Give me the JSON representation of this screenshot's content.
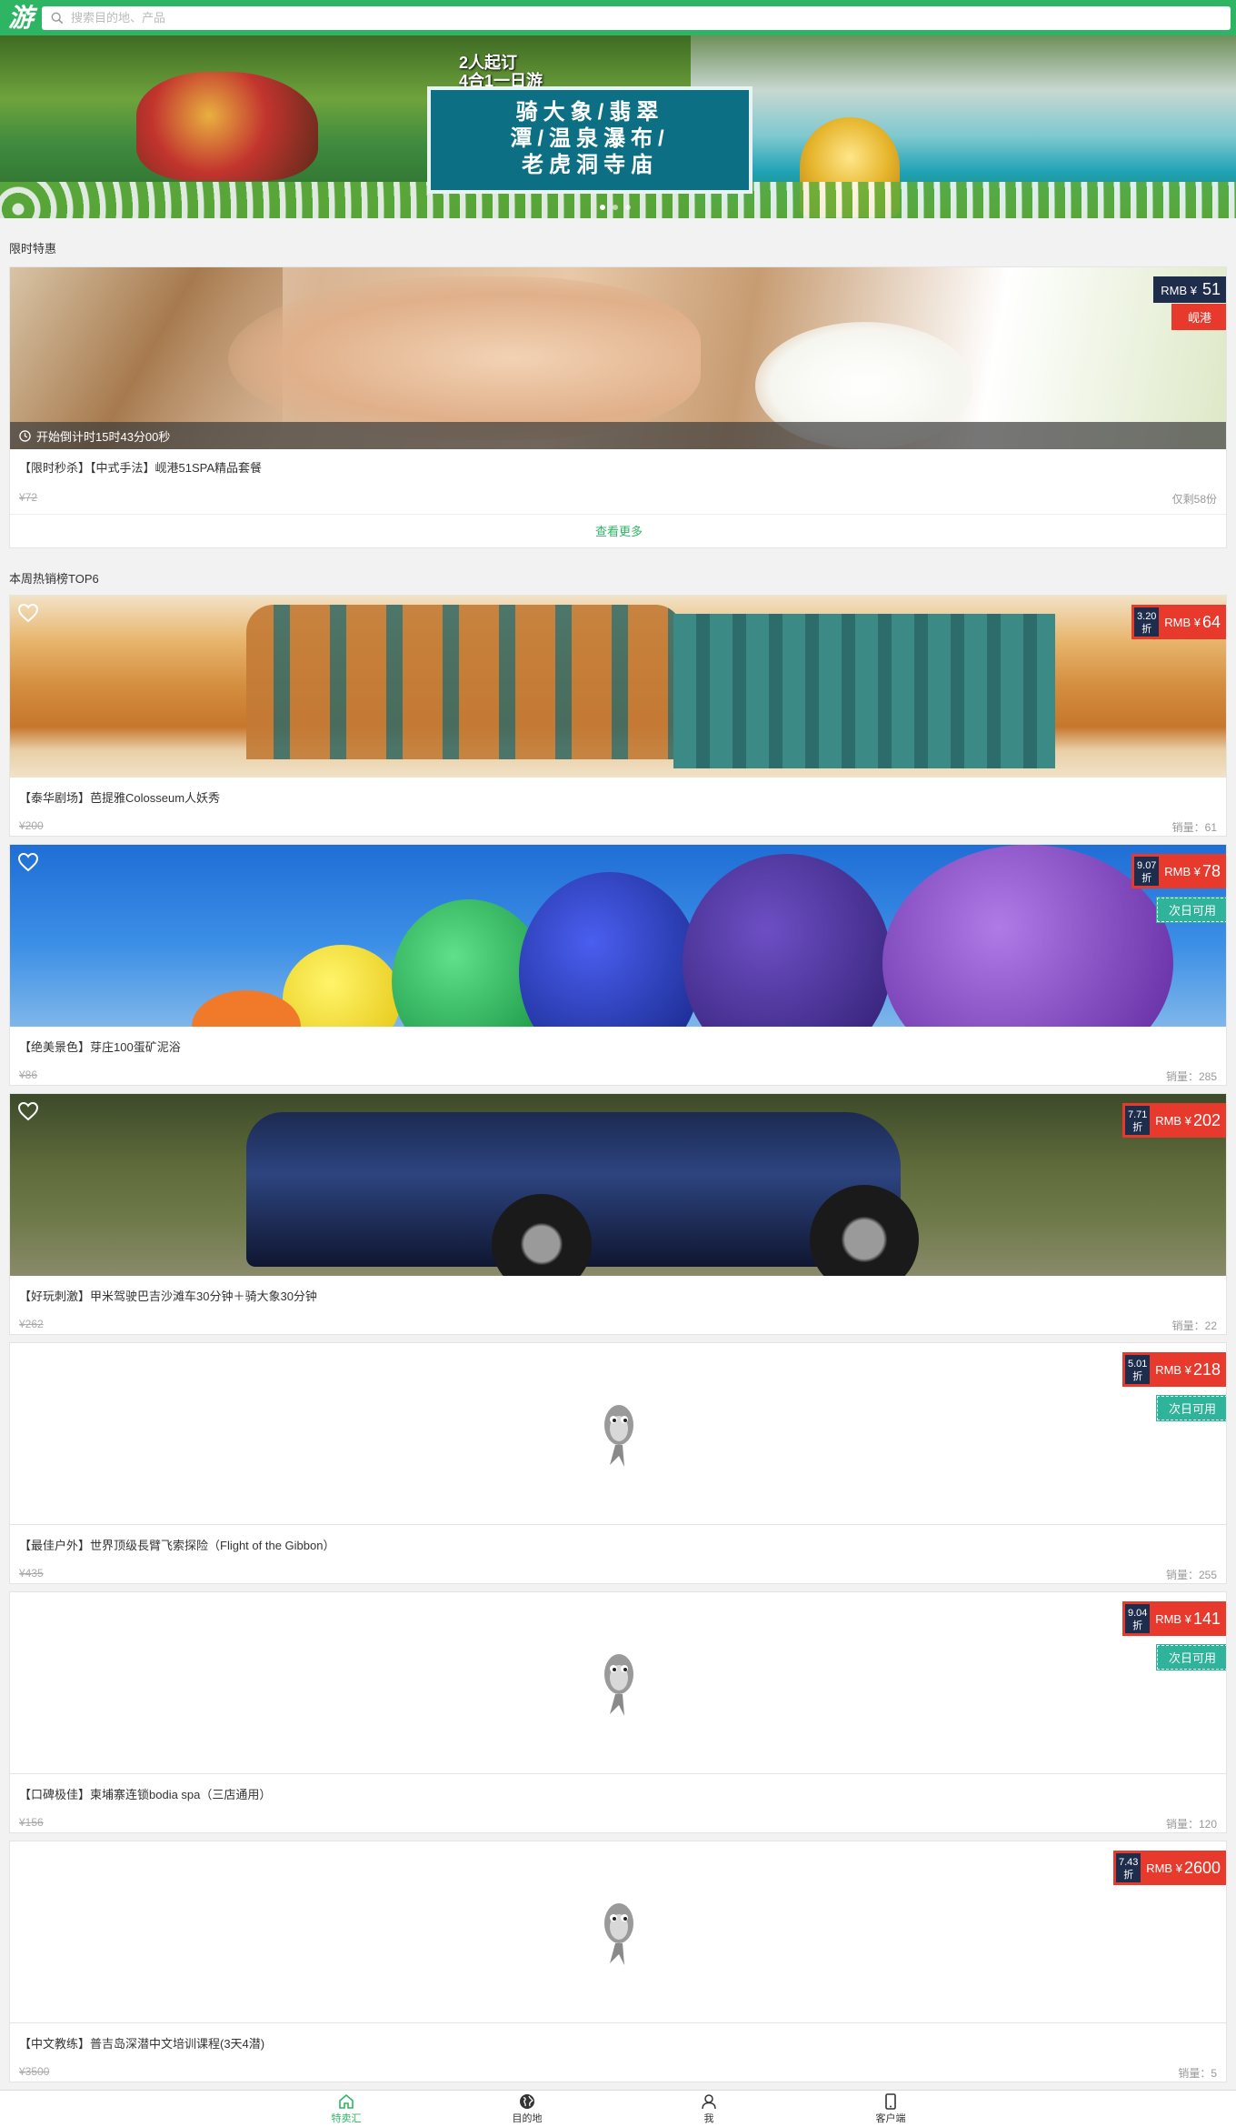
{
  "header": {
    "logo_text": "游",
    "search_placeholder": "搜索目的地、产品"
  },
  "banner": {
    "top_text_line1": "2人起订",
    "top_text_line2": "4合1一日游",
    "sign_line1": "骑大象/翡翠",
    "sign_line2": "潭/温泉瀑布/",
    "sign_line3": "老虎洞寺庙"
  },
  "flash_sale": {
    "section_title": "限时特惠",
    "price_currency": "RMB ¥",
    "price": "51",
    "city": "岘港",
    "countdown": "开始倒计时15时43分00秒",
    "title": "【限时秒杀】【中式手法】岘港51SPA精品套餐",
    "original_price": "¥72",
    "remaining": "仅剩58份",
    "more_label": "查看更多"
  },
  "top_list": {
    "section_title": "本周热销榜TOP6",
    "items": [
      {
        "discount": "3.20",
        "discount_unit": "折",
        "currency": "RMB ¥",
        "price": "64",
        "title": "【泰华剧场】芭提雅Colosseum人妖秀",
        "original_price": "¥200",
        "sales": "销量：61"
      },
      {
        "discount": "9.07",
        "discount_unit": "折",
        "currency": "RMB ¥",
        "price": "78",
        "badge": "次日可用",
        "title": "【绝美景色】芽庄100蛋矿泥浴",
        "original_price": "¥86",
        "sales": "销量：285"
      },
      {
        "discount": "7.71",
        "discount_unit": "折",
        "currency": "RMB ¥",
        "price": "202",
        "title": "【好玩刺激】甲米驾驶巴吉沙滩车30分钟＋骑大象30分钟",
        "original_price": "¥262",
        "sales": "销量：22"
      },
      {
        "discount": "5.01",
        "discount_unit": "折",
        "currency": "RMB ¥",
        "price": "218",
        "badge": "次日可用",
        "title": "【最佳户外】世界顶级長臂飞索探险（Flight of the Gibbon）",
        "original_price": "¥435",
        "sales": "销量：255"
      },
      {
        "discount": "9.04",
        "discount_unit": "折",
        "currency": "RMB ¥",
        "price": "141",
        "badge": "次日可用",
        "title": "【口碑极佳】柬埔寨连锁bodia spa（三店通用）",
        "original_price": "¥156",
        "sales": "销量：120"
      },
      {
        "discount": "7.43",
        "discount_unit": "折",
        "currency": "RMB ¥",
        "price": "2600",
        "title": "【中文教练】普吉岛深潜中文培训课程(3天4潜)",
        "original_price": "¥3500",
        "sales": "销量：5"
      }
    ]
  },
  "tabbar": {
    "items": [
      {
        "label": "特卖汇",
        "icon": "home-icon"
      },
      {
        "label": "目的地",
        "icon": "globe-icon"
      },
      {
        "label": "我",
        "icon": "user-icon"
      },
      {
        "label": "客户端",
        "icon": "phone-icon"
      }
    ]
  },
  "colors": {
    "brand_green": "#2db563",
    "price_red": "#e8392d",
    "discount_navy": "#1e2d4c",
    "badge_teal": "#2fb39a"
  }
}
